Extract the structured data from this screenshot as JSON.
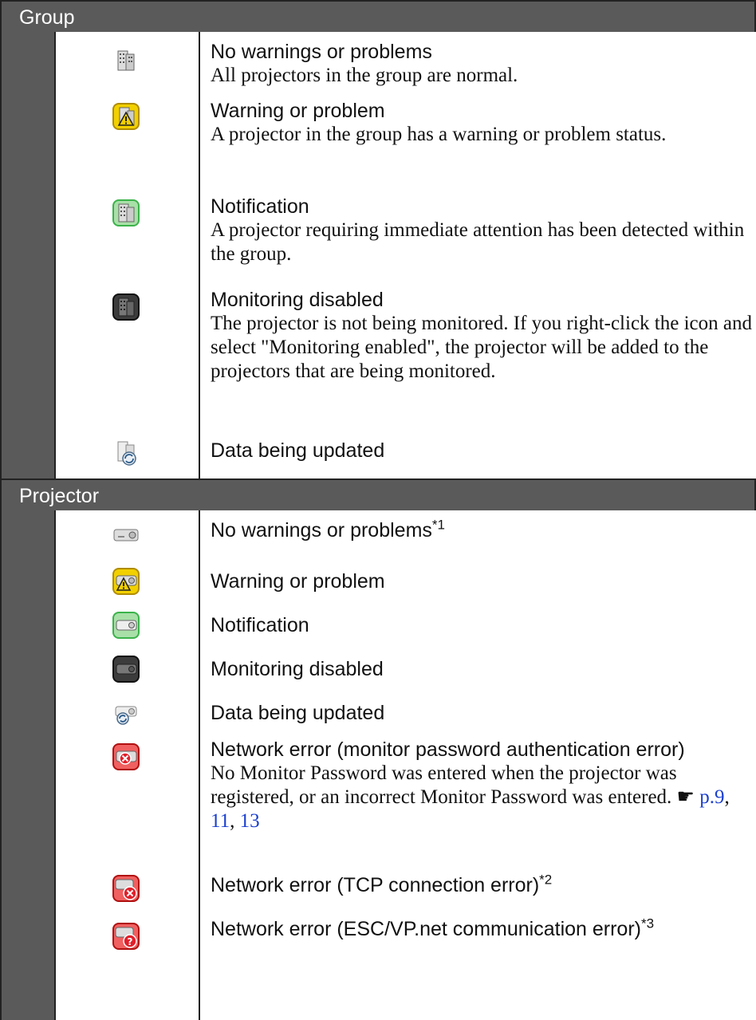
{
  "group": {
    "title": "Group",
    "rows": [
      {
        "icon": "group-normal-icon",
        "label": "No warnings or problems",
        "desc": "All projectors in the group are normal."
      },
      {
        "icon": "group-warning-icon",
        "label": "Warning or problem",
        "desc": "A projector in the group has a warning or problem status."
      },
      {
        "icon": "group-notification-icon",
        "label": "Notification",
        "desc": "A projector requiring immediate attention has been detected within the group."
      },
      {
        "icon": "group-disabled-icon",
        "label": "Monitoring disabled",
        "desc": "The projector is not being monitored. If you right-click the icon and select \"Monitoring enabled\", the projector will be added to the projectors that are being monitored."
      },
      {
        "icon": "group-updating-icon",
        "label": "Data being updated",
        "desc": ""
      }
    ]
  },
  "projector": {
    "title": "Projector",
    "rows": [
      {
        "icon": "projector-normal-icon",
        "label": "No warnings or problems",
        "sup": "*1"
      },
      {
        "icon": "projector-warning-icon",
        "label": "Warning or problem"
      },
      {
        "icon": "projector-notification-icon",
        "label": "Notification"
      },
      {
        "icon": "projector-disabled-icon",
        "label": "Monitoring disabled"
      },
      {
        "icon": "projector-updating-icon",
        "label": "Data being updated"
      },
      {
        "icon": "projector-auth-error-icon",
        "label": "Network error (monitor password authentication error)",
        "desc": "No Monitor Password was entered when the projector was registered, or an incorrect Monitor Password was entered.",
        "ref_symbol": "☛",
        "refs": [
          "p.9",
          ", ",
          "11",
          ", ",
          "13"
        ]
      },
      {
        "icon": "projector-tcp-error-icon",
        "label": "Network error (TCP connection error)",
        "sup": "*2"
      },
      {
        "icon": "projector-escvp-error-icon",
        "label": "Network error (ESC/VP.net communication error)",
        "sup": "*3"
      }
    ]
  },
  "colors": {
    "header_bg": "#5a5a5a",
    "warning": "#f2d000",
    "notification": "#3bb34a",
    "disabled": "#3c3c3c",
    "error": "#e0202a",
    "link": "#1a3fd0"
  }
}
